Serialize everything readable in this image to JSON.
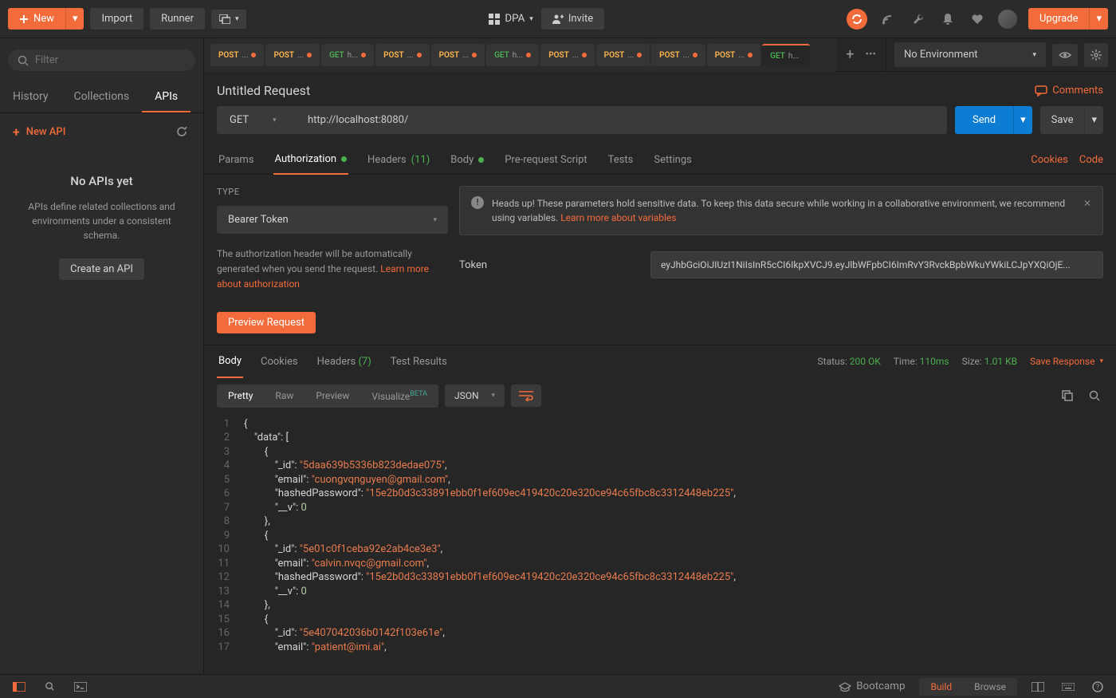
{
  "topbar": {
    "new_label": "New",
    "import_label": "Import",
    "runner_label": "Runner",
    "workspace_name": "DPA",
    "invite_label": "Invite",
    "upgrade_label": "Upgrade"
  },
  "sidebar": {
    "filter_placeholder": "Filter",
    "tabs": {
      "history": "History",
      "collections": "Collections",
      "apis": "APIs"
    },
    "new_api_label": "New API",
    "empty_title": "No APIs yet",
    "empty_text": "APIs define related collections and environments under a consistent schema.",
    "create_api_label": "Create an API"
  },
  "tabs": [
    {
      "method": "POST",
      "name": "...",
      "unsaved": true
    },
    {
      "method": "POST",
      "name": "...",
      "unsaved": true
    },
    {
      "method": "GET",
      "name": "h...",
      "unsaved": true
    },
    {
      "method": "POST",
      "name": "...",
      "unsaved": true
    },
    {
      "method": "POST",
      "name": "...",
      "unsaved": true
    },
    {
      "method": "GET",
      "name": "h...",
      "unsaved": true
    },
    {
      "method": "POST",
      "name": "...",
      "unsaved": true
    },
    {
      "method": "POST",
      "name": "...",
      "unsaved": true
    },
    {
      "method": "POST",
      "name": "...",
      "unsaved": true
    },
    {
      "method": "POST",
      "name": "...",
      "unsaved": true
    },
    {
      "method": "GET",
      "name": "h...",
      "unsaved": false,
      "active": true
    }
  ],
  "env": {
    "selected": "No Environment"
  },
  "request": {
    "title": "Untitled Request",
    "comments_label": "Comments",
    "method": "GET",
    "url": "http://localhost:8080/",
    "send_label": "Send",
    "save_label": "Save",
    "tabs": {
      "params": "Params",
      "authorization": "Authorization",
      "headers": "Headers",
      "headers_count": "(11)",
      "body": "Body",
      "prerequest": "Pre-request Script",
      "tests": "Tests",
      "settings": "Settings",
      "cookies": "Cookies",
      "code": "Code"
    },
    "auth": {
      "type_label": "TYPE",
      "type_value": "Bearer Token",
      "desc1": "The authorization header will be automatically generated when you send the request. ",
      "learn_more_auth": "Learn more about authorization",
      "preview_label": "Preview Request",
      "info_text": "Heads up! These parameters hold sensitive data. To keep this data secure while working in a collaborative environment, we recommend using variables. ",
      "learn_more_vars": "Learn more about variables",
      "token_label": "Token",
      "token_value": "eyJhbGciOiJIUzI1NiIsInR5cCI6IkpXVCJ9.eyJlbWFpbCI6ImRvY3RvckBpbWkuYWkiLCJpYXQiOjE..."
    }
  },
  "response": {
    "tabs": {
      "body": "Body",
      "cookies": "Cookies",
      "headers": "Headers",
      "headers_count": "(7)",
      "test_results": "Test Results"
    },
    "status_label": "Status:",
    "status_value": "200 OK",
    "time_label": "Time:",
    "time_value": "110ms",
    "size_label": "Size:",
    "size_value": "1.01 KB",
    "save_response_label": "Save Response",
    "views": {
      "pretty": "Pretty",
      "raw": "Raw",
      "preview": "Preview",
      "visualize": "Visualize",
      "beta": "BETA"
    },
    "format": "JSON",
    "code_lines": [
      "{",
      "    \"data\": [",
      "        {",
      "            \"_id\": \"5daa639b5336b823dedae075\",",
      "            \"email\": \"cuongvqnguyen@gmail.com\",",
      "            \"hashedPassword\": \"15e2b0d3c33891ebb0f1ef609ec419420c20e320ce94c65fbc8c3312448eb225\",",
      "            \"__v\": 0",
      "        },",
      "        {",
      "            \"_id\": \"5e01c0f1ceba92e2ab4ce3e3\",",
      "            \"email\": \"calvin.nvqc@gmail.com\",",
      "            \"hashedPassword\": \"15e2b0d3c33891ebb0f1ef609ec419420c20e320ce94c65fbc8c3312448eb225\",",
      "            \"__v\": 0",
      "        },",
      "        {",
      "            \"_id\": \"5e407042036b0142f103e61e\",",
      "            \"email\": \"patient@imi.ai\","
    ]
  },
  "statusbar": {
    "bootcamp": "Bootcamp",
    "build": "Build",
    "browse": "Browse"
  }
}
